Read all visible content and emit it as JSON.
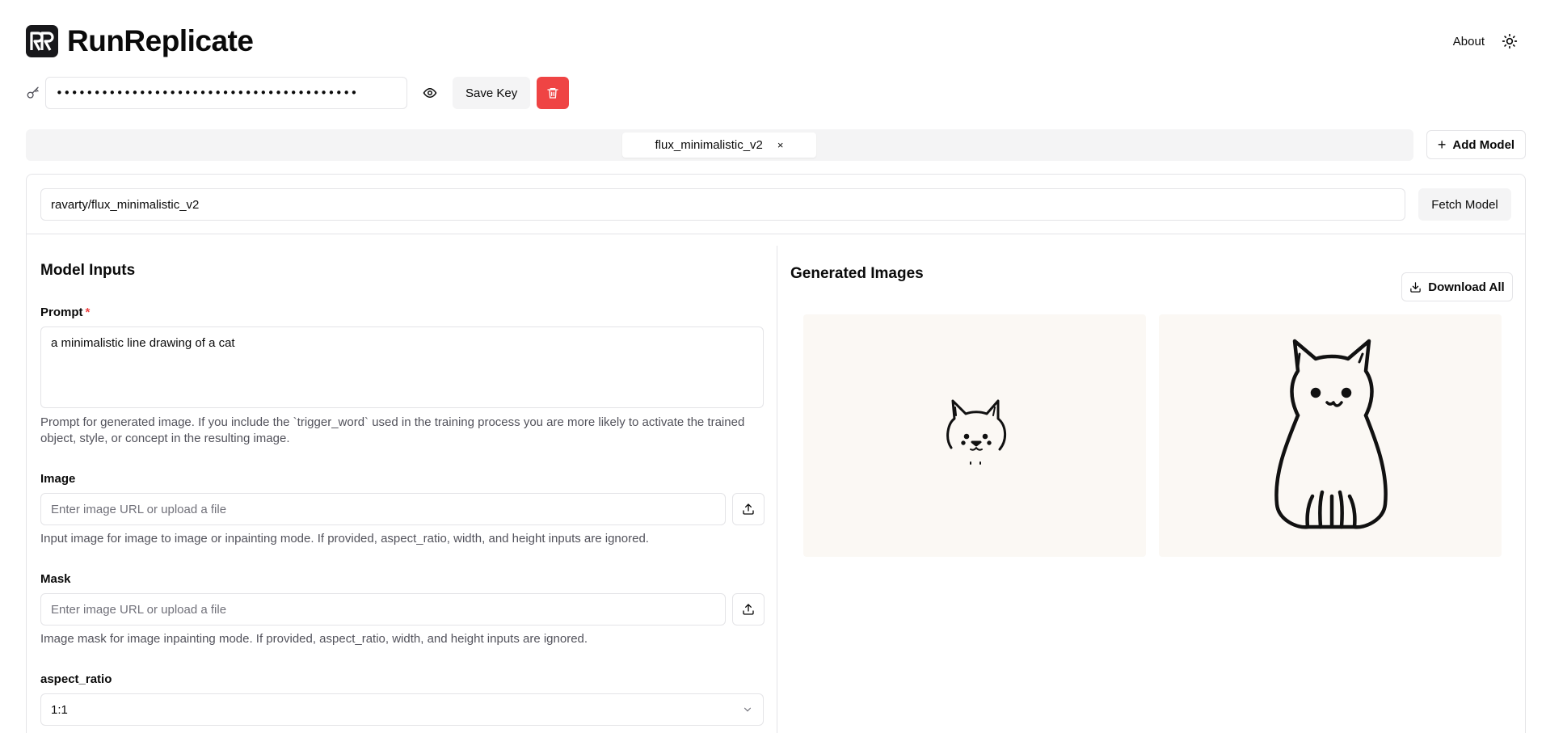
{
  "header": {
    "app_title": "RunReplicate",
    "about_label": "About"
  },
  "api_key": {
    "masked_value": "••••••••••••••••••••••••••••••••••••••••",
    "save_label": "Save Key"
  },
  "tabs": [
    {
      "label": "flux_minimalistic_v2",
      "close": "×"
    }
  ],
  "add_model_label": "Add Model",
  "model": {
    "value": "ravarty/flux_minimalistic_v2",
    "fetch_label": "Fetch Model"
  },
  "inputs": {
    "title": "Model Inputs",
    "prompt": {
      "label": "Prompt",
      "required_mark": "*",
      "value": "a minimalistic line drawing of a cat",
      "help": "Prompt for generated image. If you include the `trigger_word` used in the training process you are more likely to activate the trained object, style, or concept in the resulting image."
    },
    "image": {
      "label": "Image",
      "placeholder": "Enter image URL or upload a file",
      "help": "Input image for image to image or inpainting mode. If provided, aspect_ratio, width, and height inputs are ignored."
    },
    "mask": {
      "label": "Mask",
      "placeholder": "Enter image URL or upload a file",
      "help": "Image mask for image inpainting mode. If provided, aspect_ratio, width, and height inputs are ignored."
    },
    "aspect_ratio": {
      "label": "aspect_ratio",
      "value": "1:1"
    }
  },
  "output": {
    "title": "Generated Images",
    "download_all_label": "Download All"
  },
  "colors": {
    "accent_danger": "#ef4444",
    "muted_bg": "#f4f4f5",
    "border": "#e4e4e7"
  }
}
